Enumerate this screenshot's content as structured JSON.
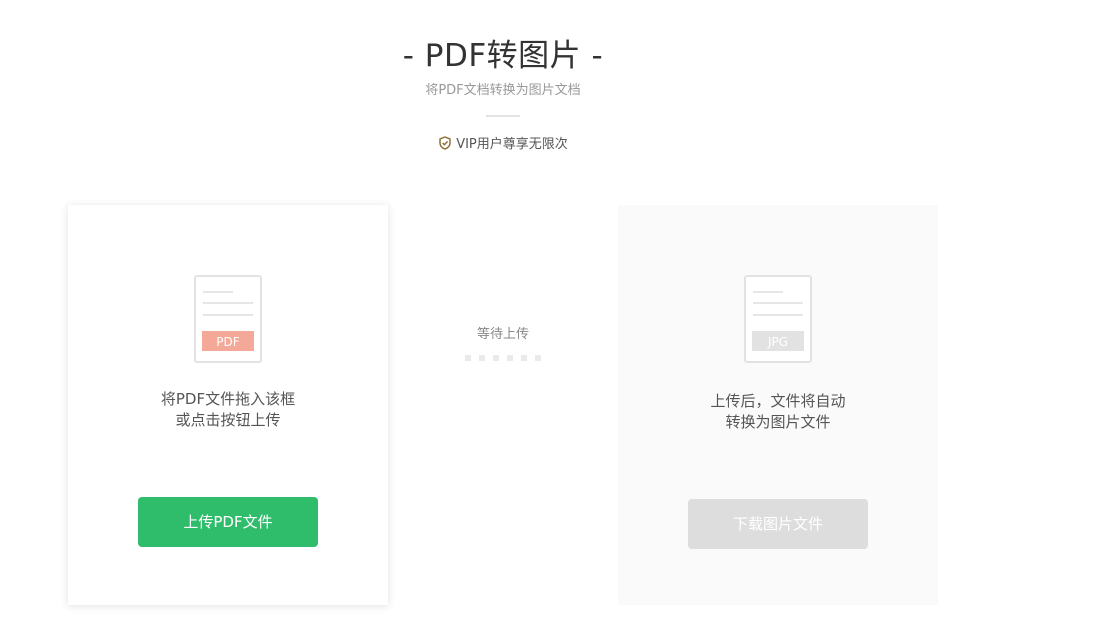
{
  "header": {
    "title": "- PDF转图片 -",
    "subtitle": "将PDF文档转换为图片文档",
    "vip_label": "VIP用户尊享无限次"
  },
  "upload_card": {
    "file_badge": "PDF",
    "line1": "将PDF文件拖入该框",
    "line2": "或点击按钮上传",
    "button_label": "上传PDF文件"
  },
  "status": {
    "waiting_label": "等待上传"
  },
  "download_card": {
    "file_badge": "JPG",
    "line1": "上传后，文件将自动",
    "line2": "转换为图片文件",
    "button_label": "下载图片文件"
  },
  "colors": {
    "primary_green": "#2fbd6b",
    "pdf_badge": "#f4a898",
    "disabled_gray": "#dddddd",
    "vip_gold": "#8a6a2e"
  }
}
